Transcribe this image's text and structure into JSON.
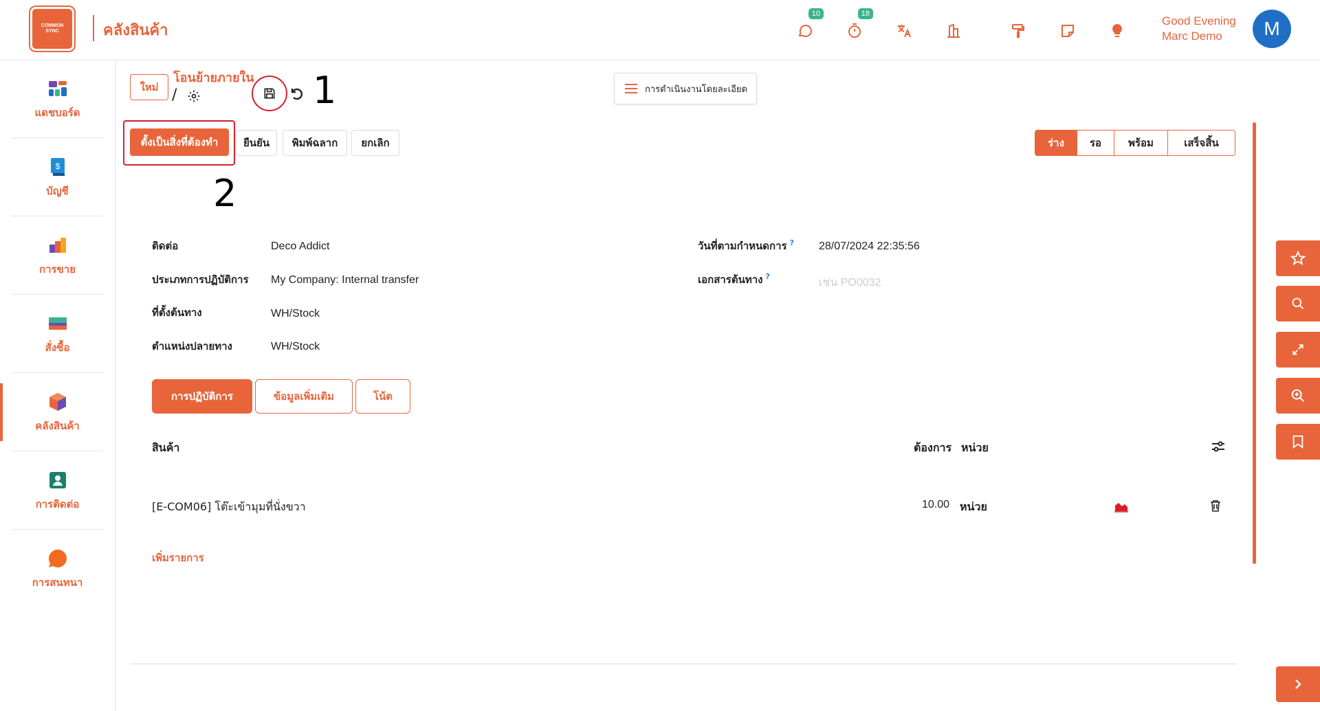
{
  "app": {
    "title": "คลังสินค้า",
    "logo_text_1": "COMMON",
    "logo_text_2": "SYNC",
    "brand_color": "#e8643a"
  },
  "topbar": {
    "chat_badge": "10",
    "activity_badge": "18",
    "greeting": "Good Evening",
    "user_name": "Marc Demo",
    "avatar_letter": "M",
    "icons": [
      "chat-icon",
      "stopwatch-icon",
      "translate-icon",
      "building-icon",
      "paint-roller-icon",
      "note-icon",
      "lightbulb-icon"
    ]
  },
  "sidebar": {
    "items": [
      {
        "label": "แดชบอร์ด",
        "icon": "dashboard-icon"
      },
      {
        "label": "บัญชี",
        "icon": "accounting-icon"
      },
      {
        "label": "การขาย",
        "icon": "sales-icon"
      },
      {
        "label": "สั่งซื้อ",
        "icon": "purchase-icon"
      },
      {
        "label": "คลังสินค้า",
        "icon": "inventory-icon"
      },
      {
        "label": "การติดต่อ",
        "icon": "contacts-icon"
      },
      {
        "label": "การสนทนา",
        "icon": "discuss-icon"
      }
    ]
  },
  "header": {
    "new_label": "ใหม่",
    "breadcrumb_title": "โอนย้ายภายใน",
    "breadcrumb_sep": "/",
    "ops_detail_label": "การดำเนินงานโดยละเอียด"
  },
  "annotations": {
    "one": "1",
    "two": "2"
  },
  "actions": {
    "mark_todo": "ตั้งเป็นสิ่งที่ต้องทำ",
    "confirm": "ยืนยัน",
    "print_labels": "พิมพ์ฉลาก",
    "cancel": "ยกเลิก"
  },
  "status": [
    "ร่าง",
    "รอ",
    "พร้อม",
    "เสร็จสิ้น"
  ],
  "form": {
    "contact_label": "ติดต่อ",
    "contact_value": "Deco Addict",
    "op_type_label": "ประเภทการปฏิบัติการ",
    "op_type_value": "My Company: Internal transfer",
    "src_loc_label": "ที่ตั้งต้นทาง",
    "src_loc_value": "WH/Stock",
    "dst_loc_label": "ตำแหน่งปลายทาง",
    "dst_loc_value": "WH/Stock",
    "scheduled_label": "วันที่ตามกำหนดการ",
    "scheduled_value": "28/07/2024 22:35:56",
    "source_doc_label": "เอกสารต้นทาง",
    "source_doc_placeholder": "เช่น PO0032",
    "help": "?"
  },
  "tabs": [
    "การปฏิบัติการ",
    "ข้อมูลเพิ่มเติม",
    "โน้ต"
  ],
  "lines": {
    "col_product": "สินค้า",
    "col_demand": "ต้องการ",
    "col_unit": "หน่วย",
    "rows": [
      {
        "product": "[E-COM06] โต๊ะเข้ามุมที่นั่งขวา",
        "qty": "10.00",
        "unit": "หน่วย"
      }
    ],
    "add_line": "เพิ่มรายการ"
  }
}
